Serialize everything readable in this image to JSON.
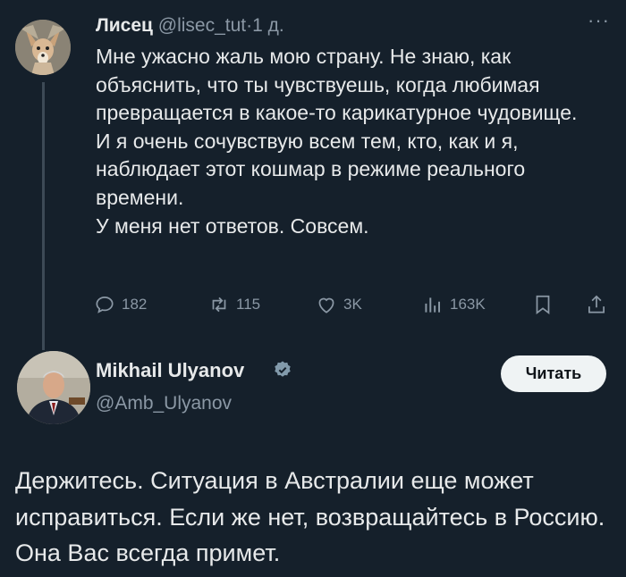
{
  "tweet1": {
    "author_name": "Лисец",
    "author_handle": "@lisec_tut",
    "separator": "·",
    "time": "1 д.",
    "more_icon": "more-dots-icon",
    "lines": [
      "Мне ужасно жаль мою страну. Не знаю, как объяснить, что ты чувствуешь, когда любимая превращается в какое-то карикатурное чудовище.",
      "И я очень сочувствую всем тем, кто, как и я, наблюдает этот кошмар в режиме реального времени.",
      "У меня нет ответов. Совсем."
    ],
    "actions": {
      "replies": "182",
      "retweets": "115",
      "likes": "3K",
      "views": "163K"
    }
  },
  "tweet2": {
    "author_name": "Mikhail Ulyanov",
    "author_handle": "@Amb_Ulyanov",
    "verified_color": "#829aab",
    "follow_label": "Читать",
    "text": "Держитесь. Ситуация в Австралии еще может исправиться. Если же нет, возвращайтесь в Россию. Она Вас всегда примет."
  },
  "colors": {
    "background": "#15202b",
    "text": "#e7e9ea",
    "muted": "#8b98a5"
  }
}
